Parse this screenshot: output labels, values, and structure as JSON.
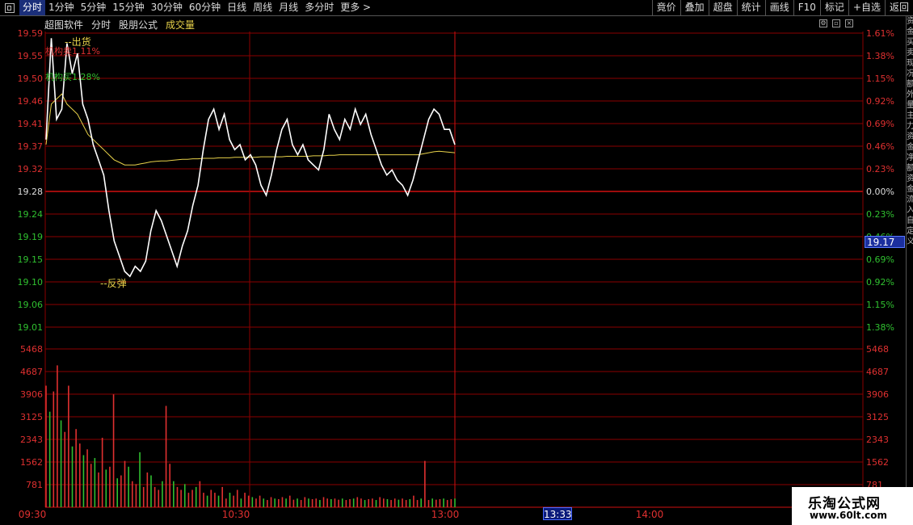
{
  "topbar": {
    "tabs": [
      "分时",
      "1分钟",
      "5分钟",
      "15分钟",
      "30分钟",
      "60分钟",
      "日线",
      "周线",
      "月线",
      "多分时",
      "更多 >"
    ],
    "active_tab": "分时",
    "right_buttons": [
      "竟价",
      "叠加",
      "超盘",
      "统计",
      "画线",
      "F10",
      "标记",
      "+自选",
      "返回"
    ]
  },
  "subbar": {
    "source": "超图软件",
    "mode": "分时",
    "formula": "股朋公式",
    "volume_label": "成交量"
  },
  "price_axis": {
    "left_labels": [
      "19.59",
      "19.55",
      "19.50",
      "19.46",
      "19.41",
      "19.37",
      "19.32",
      "19.28",
      "19.24",
      "19.19",
      "19.15",
      "19.10",
      "19.06",
      "19.01"
    ],
    "right_labels": [
      "1.61%",
      "1.38%",
      "1.15%",
      "0.92%",
      "0.69%",
      "0.46%",
      "0.23%",
      "0.00%",
      "0.23%",
      "0.46%",
      "0.69%",
      "0.92%",
      "1.15%",
      "1.38%"
    ],
    "current_price": "19.17"
  },
  "volume_axis": {
    "left_labels": [
      "5468",
      "4687",
      "3906",
      "3125",
      "2343",
      "1562",
      "781"
    ],
    "right_labels": [
      "5468",
      "4687",
      "3906",
      "3125",
      "2343",
      "1562",
      "781"
    ]
  },
  "time_axis": {
    "labels": [
      "09:30",
      "10:30",
      "13:00",
      "14:00"
    ],
    "cursor": "13:33"
  },
  "annotations": {
    "sell": "--出货",
    "buy": "--反弹",
    "inst_sell": "机构卖1.11%",
    "inst_buy": "机构买1.28%"
  },
  "watermark": {
    "line1": "乐淘公式网",
    "line2": "www.60lt.com"
  },
  "side_text": "资金买卖现况额外量主力资金净额资金流入自定义",
  "colors": {
    "grid": "#8b0000",
    "price_line": "#ffffff",
    "avg_line": "#e8d24a",
    "up": "#e03030",
    "down": "#30c030",
    "neutral_label": "#e03030"
  },
  "chart_data": {
    "type": "line",
    "title": "",
    "xlabel": "",
    "ylabel": "",
    "ylim": [
      19.01,
      19.59
    ],
    "baseline": 19.28,
    "series": [
      {
        "name": "",
        "values": [
          19.38,
          19.58,
          19.42,
          19.44,
          19.57,
          19.51,
          19.55,
          19.45,
          19.42,
          19.37,
          19.34,
          19.31,
          19.24,
          19.18,
          19.15,
          19.12,
          19.11,
          19.13,
          19.12,
          19.14,
          19.2,
          19.24,
          19.22,
          19.19,
          19.16,
          19.13,
          19.17,
          19.2,
          19.25,
          19.29,
          19.36,
          19.42,
          19.44,
          19.4,
          19.43,
          19.38,
          19.36,
          19.37,
          19.34,
          19.35,
          19.33,
          19.29,
          19.27,
          19.31,
          19.36,
          19.4,
          19.42,
          19.37,
          19.35,
          19.37,
          19.34,
          19.33,
          19.32,
          19.36,
          19.43,
          19.4,
          19.38,
          19.42,
          19.4,
          19.44,
          19.41,
          19.43,
          19.39,
          19.36,
          19.33,
          19.31,
          19.32,
          19.3,
          19.29,
          19.27,
          19.3,
          19.34,
          19.38,
          19.42,
          19.44,
          19.43,
          19.4,
          19.4,
          19.37
        ]
      },
      {
        "name": "",
        "values": [
          19.37,
          19.45,
          19.46,
          19.47,
          19.45,
          19.44,
          19.43,
          19.41,
          19.39,
          19.38,
          19.37,
          19.36,
          19.35,
          19.34,
          19.335,
          19.33,
          19.33,
          19.33,
          19.332,
          19.334,
          19.336,
          19.337,
          19.338,
          19.338,
          19.339,
          19.34,
          19.341,
          19.341,
          19.342,
          19.342,
          19.343,
          19.343,
          19.343,
          19.344,
          19.344,
          19.344,
          19.345,
          19.345,
          19.345,
          19.345,
          19.345,
          19.346,
          19.346,
          19.346,
          19.346,
          19.346,
          19.347,
          19.347,
          19.347,
          19.347,
          19.347,
          19.348,
          19.348,
          19.348,
          19.349,
          19.349,
          19.35,
          19.35,
          19.35,
          19.35,
          19.35,
          19.35,
          19.35,
          19.35,
          19.35,
          19.35,
          19.35,
          19.35,
          19.35,
          19.35,
          19.35,
          19.35,
          19.352,
          19.354,
          19.356,
          19.357,
          19.356,
          19.355,
          19.354
        ]
      }
    ],
    "volume": {
      "ylim": [
        0,
        5468
      ],
      "values": [
        4200,
        3300,
        4000,
        4900,
        3000,
        2600,
        4200,
        2100,
        2700,
        2200,
        1800,
        2000,
        1500,
        1700,
        1200,
        2400,
        1300,
        1400,
        3900,
        1000,
        1100,
        1600,
        1400,
        900,
        800,
        1900,
        700,
        1200,
        1100,
        700,
        600,
        900,
        3500,
        1500,
        900,
        700,
        600,
        800,
        500,
        600,
        700,
        900,
        500,
        400,
        600,
        500,
        400,
        700,
        300,
        500,
        400,
        600,
        300,
        500,
        400,
        350,
        300,
        400,
        300,
        250,
        350,
        300,
        280,
        350,
        300,
        400,
        260,
        300,
        250,
        350,
        300,
        280,
        300,
        250,
        350,
        300,
        280,
        300,
        260,
        300,
        250,
        280,
        300,
        350,
        300,
        250,
        280,
        300,
        250,
        350,
        300,
        280,
        250,
        300,
        260,
        300,
        250,
        280,
        400,
        250,
        300,
        1600,
        250,
        300,
        260,
        280,
        300,
        250,
        280,
        300
      ],
      "colors_up_down": "mixed"
    }
  }
}
